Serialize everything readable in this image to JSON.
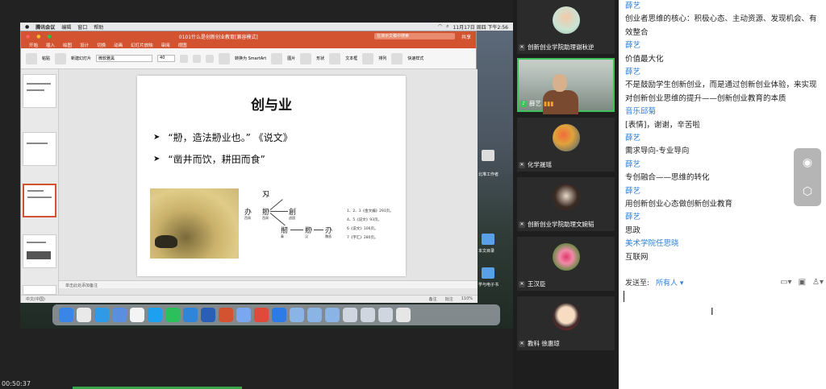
{
  "mac": {
    "menubar": {
      "app": "腾讯会议",
      "items": [
        "编辑",
        "窗口",
        "帮助"
      ],
      "clock": "11月17日 周四 下午2:56"
    }
  },
  "ppt": {
    "title": "0101什么是创新创业教育[兼容模式]",
    "search_placeholder": "在演示文稿中搜索",
    "share_label": "共享",
    "tabs": [
      "开始",
      "插入",
      "绘图",
      "设计",
      "切换",
      "动画",
      "幻灯片放映",
      "审阅",
      "视图"
    ],
    "ribbon": {
      "font_name": "微软雅黑",
      "font_size": "40",
      "paste": "粘贴",
      "new_slide": "新建幻灯片",
      "convert": "转换为 SmartArt",
      "picture": "图片",
      "shape": "形状",
      "textbox": "文本框",
      "arrange": "排列",
      "quick_styles": "快速样式"
    },
    "slide": {
      "title": "创与业",
      "bullets": [
        "“刱，造法刱业也。” 《说文》",
        "“凿井而饮，耕田而食”"
      ],
      "diagram_chars": [
        "刄",
        "办",
        "刱",
        "創",
        "剏",
        "剙",
        "刅"
      ],
      "diagram_small": [
        "西周",
        "西周",
        "战国",
        "秦",
        "汉",
        "魏晋"
      ],
      "references": [
        "1、2、3《金文编》291页。",
        "4、5《说文》93页。",
        "6《说文》106页。",
        "7《字汇》280页。"
      ]
    },
    "notes_placeholder": "单击此处添加备注",
    "status": {
      "language": "中文(中国)",
      "notes": "备注",
      "comments": "批注",
      "zoom": "110%"
    },
    "desktop_labels": [
      "北堆工作者",
      "本文目录",
      "学与电子书"
    ]
  },
  "meeting": {
    "timer": "00:50:37",
    "tiles": [
      {
        "name": "创新创业学院助理谢秋逆",
        "active": false
      },
      {
        "name": "薛艺",
        "active": true
      },
      {
        "name": "化学晟瑶",
        "active": false
      },
      {
        "name": "创新创业学院助理文婉韬",
        "active": false
      },
      {
        "name": "王汉臣",
        "active": false
      },
      {
        "name": "教科 徐惠琼",
        "active": false
      }
    ]
  },
  "chat": {
    "messages": [
      {
        "sender": "",
        "text": "创业者思维的核心：积极心态、主动资源、发现机会、有效整合"
      },
      {
        "sender": "薛艺",
        "text": "价值最大化"
      },
      {
        "sender": "薛艺",
        "text": "不是鼓励学生创新创业，而是通过创新创业体验，来实现对创新创业思维的提升——创新创业教育的本质"
      },
      {
        "sender": "音乐邱菊",
        "text": "[表情]，谢谢，辛苦啦"
      },
      {
        "sender": "薛艺",
        "text": "需求导向-专业导向"
      },
      {
        "sender": "薛艺",
        "text": "专创融合——思维的转化"
      },
      {
        "sender": "薛艺",
        "text": "用创新创业心态做创新创业教育"
      },
      {
        "sender": "薛艺",
        "text": "思政"
      },
      {
        "sender": "美术学院任思晓",
        "text": "互联网"
      }
    ],
    "send_to_label": "发送至:",
    "send_to_target": "所有人 ▾"
  },
  "colors": {
    "accent_blue": "#2f7fd8",
    "ppt_orange": "#d35230",
    "active_green": "#3bc25a"
  }
}
